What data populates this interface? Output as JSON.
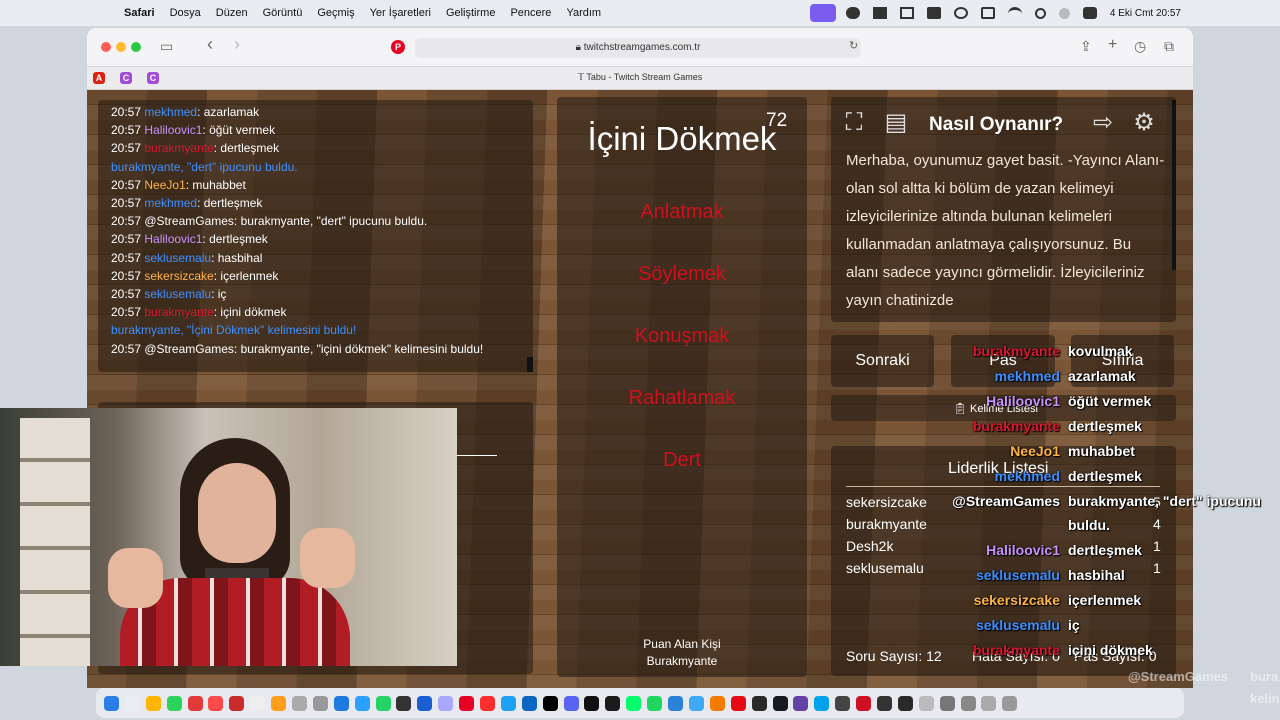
{
  "menubar": {
    "app": "Safari",
    "items": [
      "Dosya",
      "Düzen",
      "Görüntü",
      "Geçmiş",
      "Yer İşaretleri",
      "Geliştirme",
      "Pencere",
      "Yardım"
    ],
    "clock": "4 Eki Cmt  20:57"
  },
  "browser": {
    "url": "twitchstreamgames.com.tr",
    "tab_title": "Tabu - Twitch Stream Games"
  },
  "chat": [
    {
      "time": "20:57",
      "user": "mekhmed",
      "color": "blue",
      "text": ": azarlamak"
    },
    {
      "time": "20:57",
      "user": "Haliloovic1",
      "color": "purple",
      "text": ": öğüt vermek"
    },
    {
      "time": "20:57",
      "user": "burakmyante",
      "color": "red",
      "text": ": dertleşmek"
    },
    {
      "time": "",
      "user": "burakmyante,",
      "color": "blue",
      "text": " \"dert\" ipucunu buldu.",
      "system": true
    },
    {
      "time": "20:57",
      "user": "NeeJo1",
      "color": "orange",
      "text": ": muhabbet"
    },
    {
      "time": "20:57",
      "user": "mekhmed",
      "color": "blue",
      "text": ": dertleşmek"
    },
    {
      "time": "20:57",
      "user": "@StreamGames",
      "color": "white",
      "text": ": burakmyante, \"dert\" ipucunu buldu."
    },
    {
      "time": "20:57",
      "user": "Haliloovic1",
      "color": "purple",
      "text": ": dertleşmek"
    },
    {
      "time": "20:57",
      "user": "seklusemalu",
      "color": "blue",
      "text": ": hasbihal"
    },
    {
      "time": "20:57",
      "user": "sekersizcake",
      "color": "orange",
      "text": ": içerlenmek"
    },
    {
      "time": "20:57",
      "user": "seklusemalu",
      "color": "blue",
      "text": ": iç"
    },
    {
      "time": "20:57",
      "user": "burakmyante",
      "color": "red",
      "text": ": içini dökmek"
    },
    {
      "time": "",
      "user": "burakmyante,",
      "color": "blue",
      "text": " \"İçini Dökmek\" kelimesini buldu!",
      "system": true
    },
    {
      "time": "20:57",
      "user": "@StreamGames",
      "color": "white",
      "text": ": burakmyante, \"içini dökmek\" kelimesini buldu!"
    }
  ],
  "card": {
    "word": "İçini Dökmek",
    "timer": "72",
    "taboo": [
      "Anlatmak",
      "Söylemek",
      "Konuşmak",
      "Rahatlamak",
      "Dert"
    ],
    "scorer_label": "Puan Alan Kişi",
    "scorer_name": "Burakmyante"
  },
  "howto": {
    "title": "Nasıl Oynanır?",
    "text": "Merhaba, oyunumuz gayet basit. -Yayıncı Alanı- olan sol altta ki bölüm de yazan kelimeyi izleyicilerinize altında bulunan kelimeleri kullanmadan anlatmaya çalışıyorsunuz. Bu alanı sadece yayıncı görmelidir. İzleyicileriniz yayın chatinizde"
  },
  "buttons": {
    "next": "Sonraki",
    "pass": "Pas",
    "reset": "Sıfırla",
    "word_list": "Kelime Listesi"
  },
  "leaderboard": {
    "title": "Liderlik Listesi",
    "rows": [
      {
        "name": "sekersizcake",
        "score": "5"
      },
      {
        "name": "burakmyante",
        "score": "4"
      },
      {
        "name": "Desh2k",
        "score": "1"
      },
      {
        "name": "seklusemalu",
        "score": "1"
      }
    ]
  },
  "stats": {
    "questions": "Soru Sayısı: 12",
    "errors": "Hata Sayısı: 0",
    "passes": "Pas Sayısı: 0"
  },
  "overlay_chat": [
    {
      "user": "burakmyante",
      "color": "red",
      "msg": "kovulmak"
    },
    {
      "user": "mekhmed",
      "color": "blue",
      "msg": "azarlamak"
    },
    {
      "user": "Haliloovic1",
      "color": "purple",
      "msg": "öğüt vermek"
    },
    {
      "user": "burakmyante",
      "color": "red",
      "msg": "dertleşmek"
    },
    {
      "user": "NeeJo1",
      "color": "orange",
      "msg": "muhabbet"
    },
    {
      "user": "mekhmed",
      "color": "blue",
      "msg": "dertleşmek"
    },
    {
      "user": "@StreamGames",
      "color": "white",
      "msg": "burakmyante, \"dert\" ipucunu"
    },
    {
      "user": "",
      "color": "white",
      "msg": "buldu."
    },
    {
      "user": "Haliloovic1",
      "color": "purple",
      "msg": "dertleşmek"
    },
    {
      "user": "seklusemalu",
      "color": "blue",
      "msg": "hasbihal"
    },
    {
      "user": "sekersizcake",
      "color": "orange",
      "msg": "içerlenmek"
    },
    {
      "user": "seklusemalu",
      "color": "blue",
      "msg": "iç"
    },
    {
      "user": "burakmyante",
      "color": "red",
      "msg": "içini dökmek"
    }
  ],
  "watermark": {
    "user": "@StreamGames",
    "frag1": "bura",
    "frag2": "kelin"
  }
}
